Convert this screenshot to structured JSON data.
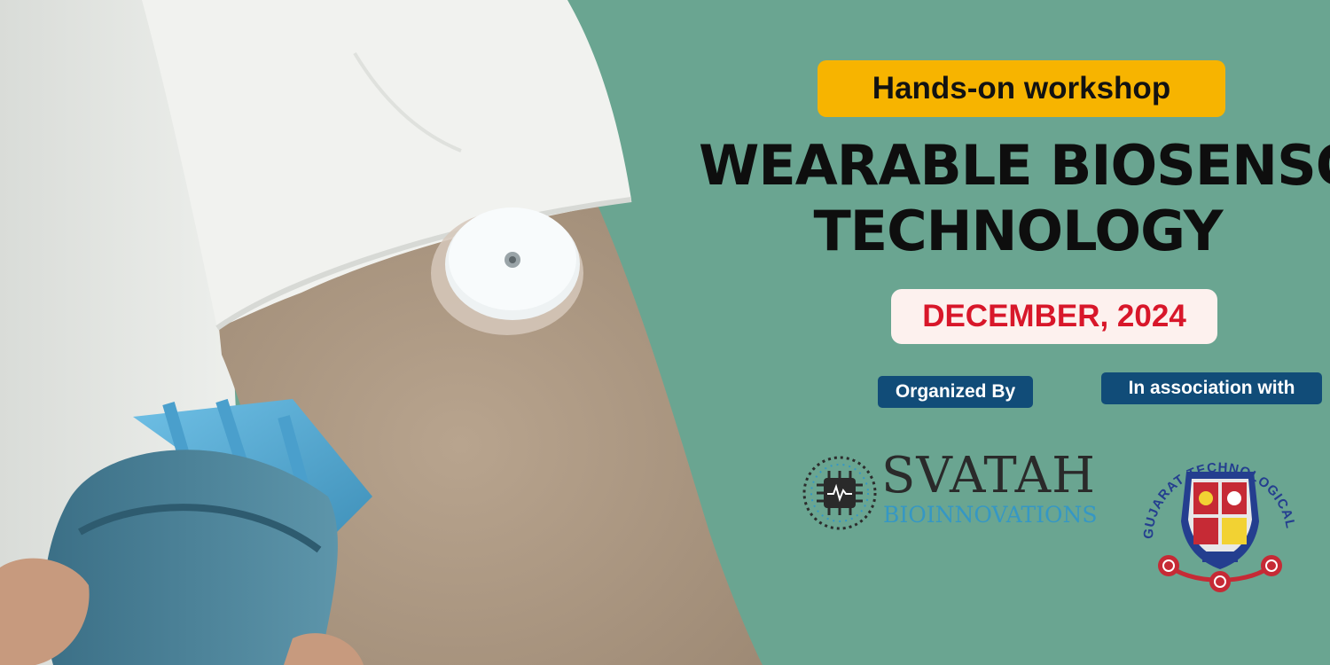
{
  "colors": {
    "background": "#6aa591",
    "badge": "#f7b400",
    "date_text": "#d8172a",
    "tag": "#114c78"
  },
  "workshop_badge": "Hands-on workshop",
  "title_line1": "WEARABLE BIOSENSOR",
  "title_line2": "TECHNOLOGY",
  "date": "DECEMBER, 2024",
  "organized_by_label": "Organized By",
  "association_label": "In association with",
  "organizer": {
    "name": "SVATAH",
    "subtitle": "BIOINNOVATIONS",
    "icon": "chip-wave-icon"
  },
  "partner": {
    "name": "GUJARAT TECHNOLOGICAL UNIVERSITY",
    "icon": "university-seal-icon"
  },
  "photo": {
    "icon": "arm-biosensor-photo"
  }
}
